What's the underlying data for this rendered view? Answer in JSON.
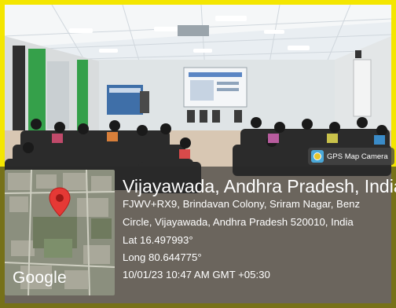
{
  "badge": {
    "label": "GPS Map Camera",
    "icon": "gps-map-camera-logo-icon"
  },
  "location": {
    "title": "Vijayawada, Andhra Pradesh, India",
    "address_line1": "FJWV+RX9, Brindavan Colony, Sriram Nagar, Benz",
    "address_line2": "Circle, Vijayawada, Andhra Pradesh 520010, India",
    "lat": "Lat 16.497993°",
    "long": "Long 80.644775°",
    "datetime": "10/01/23 10:47 AM GMT +05:30"
  },
  "map": {
    "logo_text": "Google",
    "pin_color": "#e53935",
    "pin_icon": "map-pin-icon"
  },
  "colors": {
    "frame": "#f4e600",
    "overlay": "#2a2a2a"
  }
}
